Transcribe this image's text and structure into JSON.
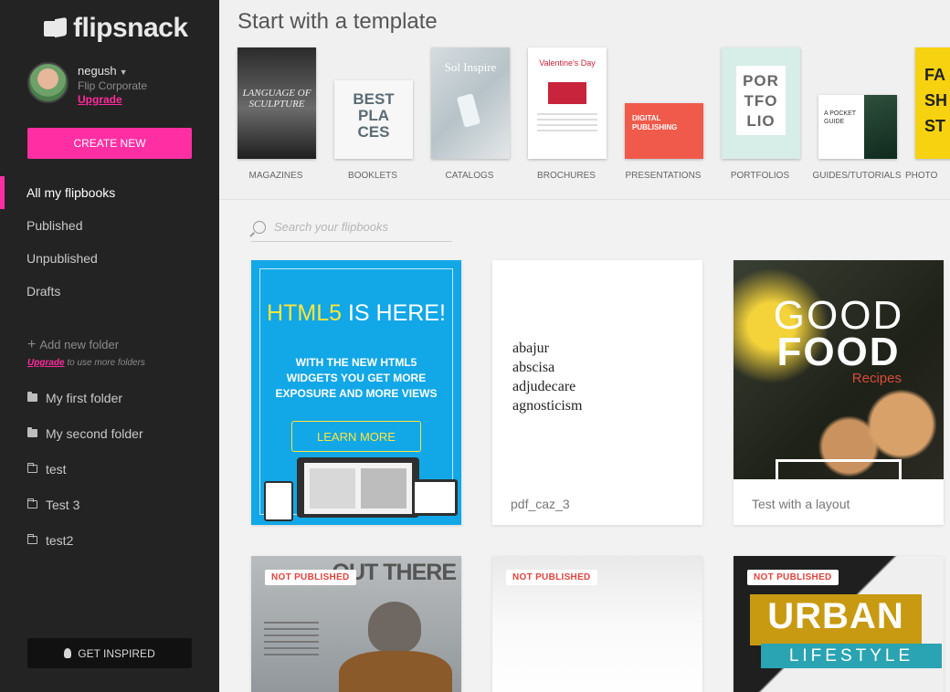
{
  "app": {
    "logo_text": "flipsnack"
  },
  "user": {
    "name": "negush",
    "plan": "Flip Corporate",
    "upgrade_label": "Upgrade"
  },
  "sidebar": {
    "create_label": "CREATE NEW",
    "nav": [
      {
        "label": "All my flipbooks",
        "active": true
      },
      {
        "label": "Published"
      },
      {
        "label": "Unpublished"
      },
      {
        "label": "Drafts"
      }
    ],
    "add_folder_label": "Add new folder",
    "upgrade_link": "Upgrade",
    "upgrade_note": " to use more folders",
    "folders": [
      {
        "label": "My first folder",
        "icon": "folder-filled-icon"
      },
      {
        "label": "My second folder",
        "icon": "folder-filled-icon"
      },
      {
        "label": "test",
        "icon": "folder-outline-icon"
      },
      {
        "label": "Test 3",
        "icon": "folder-outline-icon"
      },
      {
        "label": "test2",
        "icon": "folder-outline-icon"
      }
    ],
    "inspired_label": "GET INSPIRED"
  },
  "templates": {
    "title": "Start with a template",
    "items": [
      {
        "label": "MAGAZINES",
        "cover_text": "LANGUAGE OF SCULPTURE"
      },
      {
        "label": "BOOKLETS",
        "cover_text": "BEST PLA CES"
      },
      {
        "label": "CATALOGS",
        "cover_text": "Sol Inspire"
      },
      {
        "label": "BROCHURES",
        "cover_text": "Valentine's Day"
      },
      {
        "label": "PRESENTATIONS",
        "cover_text": "DIGITAL PUBLISHING"
      },
      {
        "label": "PORTFOLIOS",
        "cover_text": "POR TFO LIO"
      },
      {
        "label": "GUIDES/TUTORIALS",
        "cover_text": "A POCKET GUIDE"
      },
      {
        "label": "PHOTO",
        "cover_text": "FASH ST"
      }
    ]
  },
  "search": {
    "placeholder": "Search your flipbooks"
  },
  "cards": {
    "promo": {
      "head_hl": "HTML5",
      "head_rest": " IS HERE!",
      "sub": "WITH THE NEW HTML5 WIDGETS YOU GET MORE EXPOSURE AND MORE VIEWS",
      "button": "LEARN MORE"
    },
    "items": [
      {
        "caption": "pdf_caz_3",
        "words": [
          "abajur",
          "abscisa",
          "adjudecare",
          "agnosticism"
        ]
      },
      {
        "caption": "Test with a layout",
        "cover_title_1": "GOOD",
        "cover_title_2": "FOOD",
        "cover_sub": "Recipes"
      },
      {
        "badge": "NOT PUBLISHED",
        "cover_title": "OUT THERE"
      },
      {
        "badge": "NOT PUBLISHED"
      },
      {
        "badge": "NOT PUBLISHED",
        "cover_title_1": "URBAN",
        "cover_title_2": "LIFESTYLE"
      }
    ]
  },
  "colors": {
    "accent": "#ff2fa3",
    "sidebar_bg": "#232323",
    "promo_bg": "#12a7e6",
    "promo_highlight": "#ffe63a",
    "badge_text": "#e0433d"
  }
}
